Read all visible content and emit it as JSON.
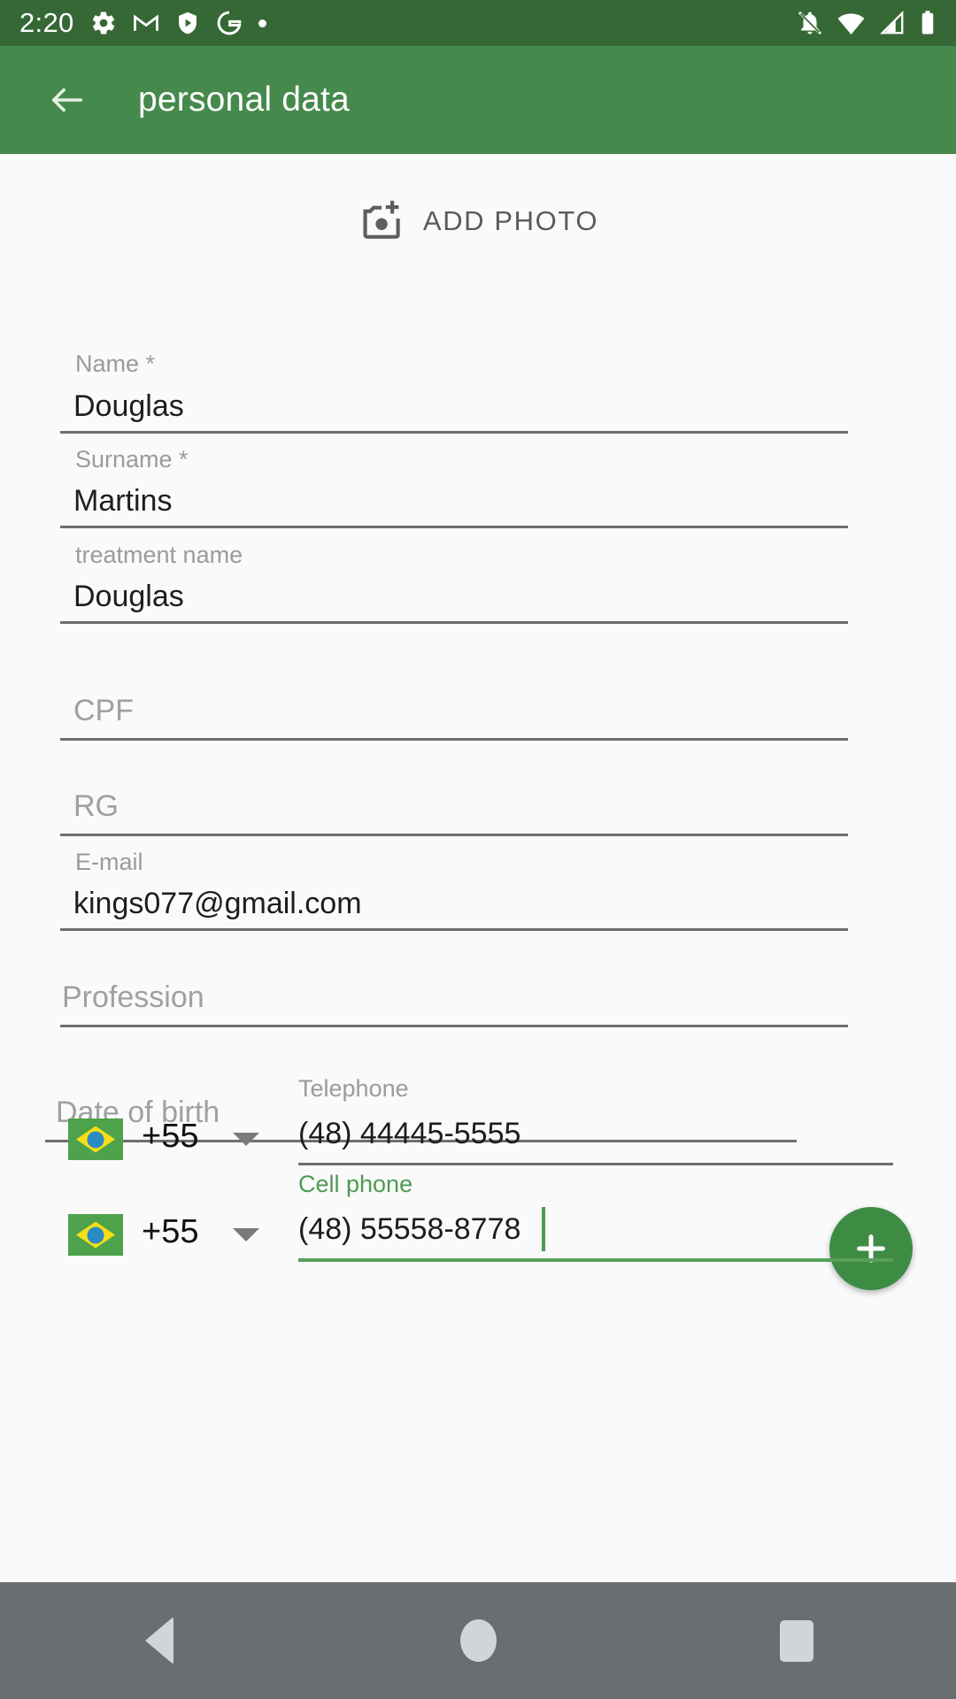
{
  "status_bar": {
    "time": "2:20",
    "left_icons": [
      "gear-icon",
      "gmail-icon",
      "play-protect-icon",
      "google-icon",
      "dot-icon"
    ],
    "right_icons": [
      "notifications-off-icon",
      "wifi-icon",
      "cellular-signal-icon",
      "battery-icon"
    ],
    "background_color": "#366835"
  },
  "app_bar": {
    "title": "personal data",
    "back_icon": "arrow-left-icon",
    "background_color": "#45894C",
    "text_color": "#FFFFFF"
  },
  "add_photo": {
    "label": "ADD PHOTO",
    "icon": "add-a-photo-icon"
  },
  "form": {
    "fields": [
      {
        "id": "name",
        "label": "Name *",
        "value": "Douglas",
        "placeholder": "",
        "filled": true,
        "focused": false
      },
      {
        "id": "surname",
        "label": "Surname *",
        "value": "Martins",
        "placeholder": "",
        "filled": true,
        "focused": false
      },
      {
        "id": "treatment_name",
        "label": "treatment name",
        "value": "Douglas",
        "placeholder": "",
        "filled": true,
        "focused": false
      },
      {
        "id": "cpf",
        "label": "",
        "value": "",
        "placeholder": "CPF",
        "filled": false,
        "focused": false
      },
      {
        "id": "rg",
        "label": "",
        "value": "",
        "placeholder": "RG",
        "filled": false,
        "focused": false
      },
      {
        "id": "email",
        "label": "E-mail",
        "value": "kings077@gmail.com",
        "placeholder": "",
        "filled": true,
        "focused": false
      },
      {
        "id": "profession",
        "label": "",
        "value": "",
        "placeholder": "Profession",
        "filled": false,
        "focused": false
      },
      {
        "id": "date_of_birth",
        "label": "",
        "value": "",
        "placeholder": "Date of birth",
        "filled": false,
        "focused": false
      }
    ],
    "phones": [
      {
        "id": "telephone",
        "label": "Telephone",
        "value": "(48) 44445-5555",
        "country_code": "+55",
        "country_flag": "brazil-flag-icon",
        "focused": false
      },
      {
        "id": "cell_phone",
        "label": "Cell phone",
        "value": "(48) 55558-8778",
        "country_code": "+55",
        "country_flag": "brazil-flag-icon",
        "focused": true
      }
    ]
  },
  "fab": {
    "icon": "plus-icon",
    "color": "#3E8C44"
  },
  "nav_bar": {
    "back": "back-triangle-icon",
    "home": "home-circle-icon",
    "recents": "recents-square-icon",
    "background_color": "#6B6E70"
  },
  "colors": {
    "accent_green": "#45894C",
    "focus_green": "#4E9A53",
    "page_background": "#FAFAFA",
    "label_gray": "#9B9B9B",
    "underline_gray": "#6E6E6E"
  }
}
